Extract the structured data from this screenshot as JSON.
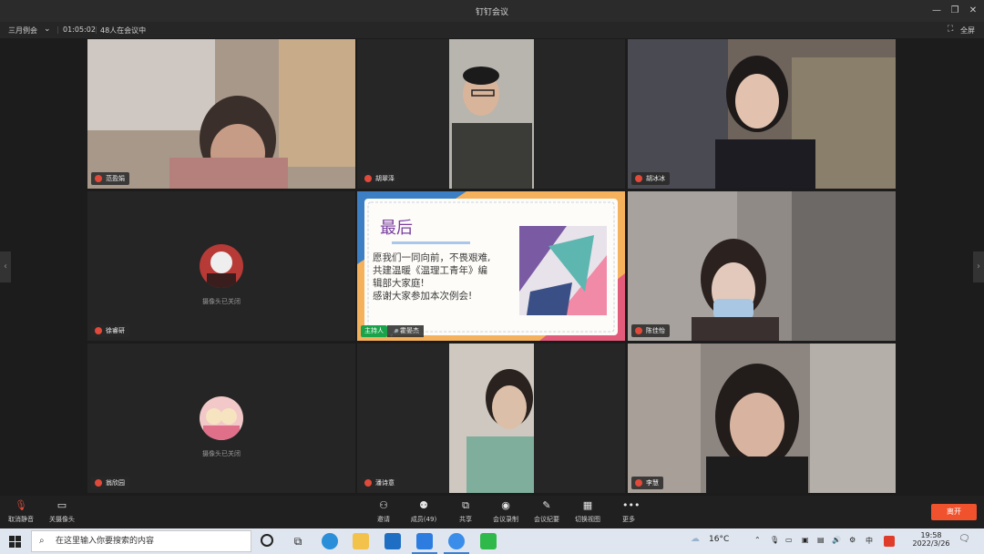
{
  "window": {
    "title": "钉钉会议"
  },
  "meeting": {
    "name": "三月例会",
    "timer": "01:05:02",
    "attendance": "48人在会议中",
    "fullscreen_label": "全屏"
  },
  "participants": [
    {
      "name": "范盈娟"
    },
    {
      "name": "胡翠泽"
    },
    {
      "name": "胡冰冰"
    },
    {
      "name": "徐睿研",
      "camera_off_text": "摄像头已关闭"
    },
    {
      "name": "陈佳怡"
    },
    {
      "name": "翁欣园",
      "camera_off_text": "摄像头已关闭"
    },
    {
      "name": "潘诗意"
    },
    {
      "name": "李慧"
    }
  ],
  "presenter": {
    "host_label": "主持人",
    "name": "霍晏杰",
    "slide": {
      "title": "最后",
      "lines": [
        "愿我们一同向前，不畏艰难,",
        "共建温暖《温理工青年》编",
        "辑部大家庭!",
        "感谢大家参加本次例会!"
      ]
    }
  },
  "toolbar": {
    "mute": "取消静音",
    "camera": "关摄像头",
    "invite": "邀请",
    "members": "成员(49)",
    "share": "共享",
    "record": "会议录制",
    "minutes": "会议纪要",
    "view": "切换视图",
    "more": "更多",
    "leave": "离开"
  },
  "taskbar": {
    "search_placeholder": "在这里输入你要搜索的内容",
    "weather": "16°C",
    "time": "19:58",
    "date": "2022/3/26"
  },
  "colors": {
    "leave": "#f0522d",
    "host_badge": "#1aa34a",
    "slide_title": "#7a3fa0"
  }
}
